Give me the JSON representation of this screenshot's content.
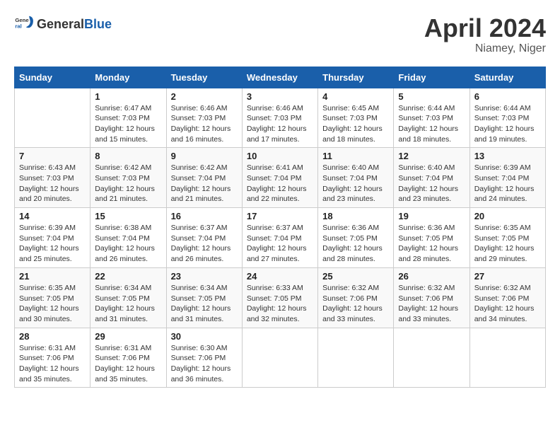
{
  "header": {
    "logo_general": "General",
    "logo_blue": "Blue",
    "month_year": "April 2024",
    "location": "Niamey, Niger"
  },
  "days_of_week": [
    "Sunday",
    "Monday",
    "Tuesday",
    "Wednesday",
    "Thursday",
    "Friday",
    "Saturday"
  ],
  "weeks": [
    [
      {
        "day": "",
        "sunrise": "",
        "sunset": "",
        "daylight": ""
      },
      {
        "day": "1",
        "sunrise": "Sunrise: 6:47 AM",
        "sunset": "Sunset: 7:03 PM",
        "daylight": "Daylight: 12 hours and 15 minutes."
      },
      {
        "day": "2",
        "sunrise": "Sunrise: 6:46 AM",
        "sunset": "Sunset: 7:03 PM",
        "daylight": "Daylight: 12 hours and 16 minutes."
      },
      {
        "day": "3",
        "sunrise": "Sunrise: 6:46 AM",
        "sunset": "Sunset: 7:03 PM",
        "daylight": "Daylight: 12 hours and 17 minutes."
      },
      {
        "day": "4",
        "sunrise": "Sunrise: 6:45 AM",
        "sunset": "Sunset: 7:03 PM",
        "daylight": "Daylight: 12 hours and 18 minutes."
      },
      {
        "day": "5",
        "sunrise": "Sunrise: 6:44 AM",
        "sunset": "Sunset: 7:03 PM",
        "daylight": "Daylight: 12 hours and 18 minutes."
      },
      {
        "day": "6",
        "sunrise": "Sunrise: 6:44 AM",
        "sunset": "Sunset: 7:03 PM",
        "daylight": "Daylight: 12 hours and 19 minutes."
      }
    ],
    [
      {
        "day": "7",
        "sunrise": "Sunrise: 6:43 AM",
        "sunset": "Sunset: 7:03 PM",
        "daylight": "Daylight: 12 hours and 20 minutes."
      },
      {
        "day": "8",
        "sunrise": "Sunrise: 6:42 AM",
        "sunset": "Sunset: 7:03 PM",
        "daylight": "Daylight: 12 hours and 21 minutes."
      },
      {
        "day": "9",
        "sunrise": "Sunrise: 6:42 AM",
        "sunset": "Sunset: 7:04 PM",
        "daylight": "Daylight: 12 hours and 21 minutes."
      },
      {
        "day": "10",
        "sunrise": "Sunrise: 6:41 AM",
        "sunset": "Sunset: 7:04 PM",
        "daylight": "Daylight: 12 hours and 22 minutes."
      },
      {
        "day": "11",
        "sunrise": "Sunrise: 6:40 AM",
        "sunset": "Sunset: 7:04 PM",
        "daylight": "Daylight: 12 hours and 23 minutes."
      },
      {
        "day": "12",
        "sunrise": "Sunrise: 6:40 AM",
        "sunset": "Sunset: 7:04 PM",
        "daylight": "Daylight: 12 hours and 23 minutes."
      },
      {
        "day": "13",
        "sunrise": "Sunrise: 6:39 AM",
        "sunset": "Sunset: 7:04 PM",
        "daylight": "Daylight: 12 hours and 24 minutes."
      }
    ],
    [
      {
        "day": "14",
        "sunrise": "Sunrise: 6:39 AM",
        "sunset": "Sunset: 7:04 PM",
        "daylight": "Daylight: 12 hours and 25 minutes."
      },
      {
        "day": "15",
        "sunrise": "Sunrise: 6:38 AM",
        "sunset": "Sunset: 7:04 PM",
        "daylight": "Daylight: 12 hours and 26 minutes."
      },
      {
        "day": "16",
        "sunrise": "Sunrise: 6:37 AM",
        "sunset": "Sunset: 7:04 PM",
        "daylight": "Daylight: 12 hours and 26 minutes."
      },
      {
        "day": "17",
        "sunrise": "Sunrise: 6:37 AM",
        "sunset": "Sunset: 7:04 PM",
        "daylight": "Daylight: 12 hours and 27 minutes."
      },
      {
        "day": "18",
        "sunrise": "Sunrise: 6:36 AM",
        "sunset": "Sunset: 7:05 PM",
        "daylight": "Daylight: 12 hours and 28 minutes."
      },
      {
        "day": "19",
        "sunrise": "Sunrise: 6:36 AM",
        "sunset": "Sunset: 7:05 PM",
        "daylight": "Daylight: 12 hours and 28 minutes."
      },
      {
        "day": "20",
        "sunrise": "Sunrise: 6:35 AM",
        "sunset": "Sunset: 7:05 PM",
        "daylight": "Daylight: 12 hours and 29 minutes."
      }
    ],
    [
      {
        "day": "21",
        "sunrise": "Sunrise: 6:35 AM",
        "sunset": "Sunset: 7:05 PM",
        "daylight": "Daylight: 12 hours and 30 minutes."
      },
      {
        "day": "22",
        "sunrise": "Sunrise: 6:34 AM",
        "sunset": "Sunset: 7:05 PM",
        "daylight": "Daylight: 12 hours and 31 minutes."
      },
      {
        "day": "23",
        "sunrise": "Sunrise: 6:34 AM",
        "sunset": "Sunset: 7:05 PM",
        "daylight": "Daylight: 12 hours and 31 minutes."
      },
      {
        "day": "24",
        "sunrise": "Sunrise: 6:33 AM",
        "sunset": "Sunset: 7:05 PM",
        "daylight": "Daylight: 12 hours and 32 minutes."
      },
      {
        "day": "25",
        "sunrise": "Sunrise: 6:32 AM",
        "sunset": "Sunset: 7:06 PM",
        "daylight": "Daylight: 12 hours and 33 minutes."
      },
      {
        "day": "26",
        "sunrise": "Sunrise: 6:32 AM",
        "sunset": "Sunset: 7:06 PM",
        "daylight": "Daylight: 12 hours and 33 minutes."
      },
      {
        "day": "27",
        "sunrise": "Sunrise: 6:32 AM",
        "sunset": "Sunset: 7:06 PM",
        "daylight": "Daylight: 12 hours and 34 minutes."
      }
    ],
    [
      {
        "day": "28",
        "sunrise": "Sunrise: 6:31 AM",
        "sunset": "Sunset: 7:06 PM",
        "daylight": "Daylight: 12 hours and 35 minutes."
      },
      {
        "day": "29",
        "sunrise": "Sunrise: 6:31 AM",
        "sunset": "Sunset: 7:06 PM",
        "daylight": "Daylight: 12 hours and 35 minutes."
      },
      {
        "day": "30",
        "sunrise": "Sunrise: 6:30 AM",
        "sunset": "Sunset: 7:06 PM",
        "daylight": "Daylight: 12 hours and 36 minutes."
      },
      {
        "day": "",
        "sunrise": "",
        "sunset": "",
        "daylight": ""
      },
      {
        "day": "",
        "sunrise": "",
        "sunset": "",
        "daylight": ""
      },
      {
        "day": "",
        "sunrise": "",
        "sunset": "",
        "daylight": ""
      },
      {
        "day": "",
        "sunrise": "",
        "sunset": "",
        "daylight": ""
      }
    ]
  ]
}
